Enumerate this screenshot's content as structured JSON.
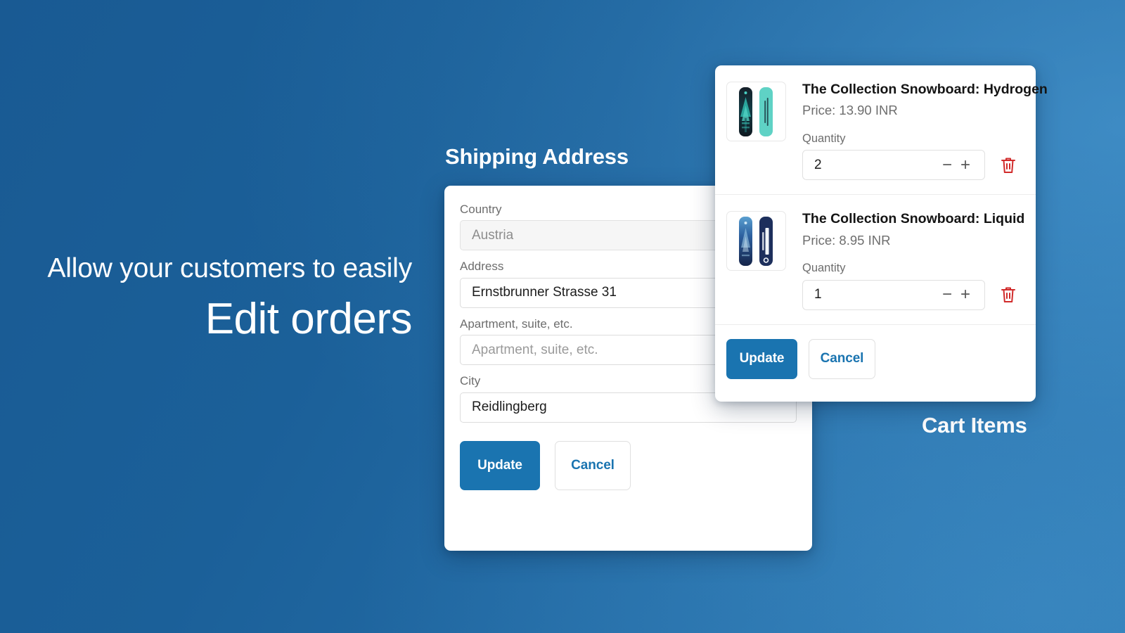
{
  "hero": {
    "line1": "Allow your customers to easily",
    "line2": "Edit orders"
  },
  "captions": {
    "shipping": "Shipping Address",
    "cart": "Cart Items"
  },
  "colors": {
    "accent": "#1a74b0",
    "background_dark": "#195a93",
    "background_light": "#2d79b4",
    "danger": "#d12b2b",
    "card": "#ffffff"
  },
  "shipping_form": {
    "fields": [
      {
        "label": "Country",
        "value": "Austria",
        "placeholder": "Country",
        "disabled": true,
        "is_placeholder": false
      },
      {
        "label": "Address",
        "value": "Ernstbrunner Strasse 31",
        "placeholder": "Address",
        "disabled": false,
        "is_placeholder": false
      },
      {
        "label": "Apartment, suite, etc.",
        "value": "Apartment, suite, etc.",
        "placeholder": "Apartment, suite, etc.",
        "disabled": false,
        "is_placeholder": true
      },
      {
        "label": "City",
        "value": "Reidlingberg",
        "placeholder": "City",
        "disabled": false,
        "is_placeholder": false
      }
    ],
    "update_label": "Update",
    "cancel_label": "Cancel"
  },
  "cart": {
    "items": [
      {
        "title": "The Collection Snowboard: Hydrogen",
        "price": "Price: 13.90 INR",
        "quantity_label": "Quantity",
        "quantity": "2",
        "decrement_label": "−",
        "increment_label": "+",
        "remove_icon": "trash-icon",
        "thumbnail": "snowboard-hydrogen-thumbnail"
      },
      {
        "title": "The Collection Snowboard: Liquid",
        "price": "Price: 8.95 INR",
        "quantity_label": "Quantity",
        "quantity": "1",
        "decrement_label": "−",
        "increment_label": "+",
        "remove_icon": "trash-icon",
        "thumbnail": "snowboard-liquid-thumbnail"
      }
    ],
    "update_label": "Update",
    "cancel_label": "Cancel"
  }
}
